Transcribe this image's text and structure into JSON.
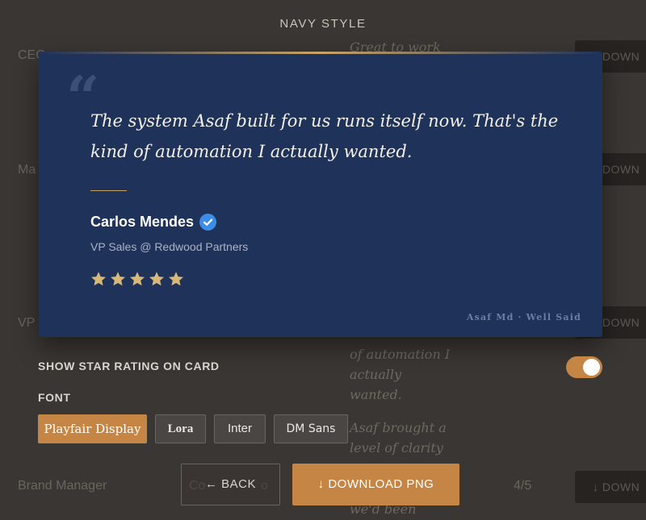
{
  "background": {
    "rows": [
      {
        "label": "CEO",
        "top": 0
      },
      {
        "label": "Ma",
        "top": 0
      },
      {
        "label": "VP",
        "top": 0
      },
      {
        "label": "Brand Manager",
        "top": 0
      }
    ],
    "company_partial": "Co",
    "company_partial_2": "o",
    "quotes": [
      "Great to work",
      "of automation I actually wanted.",
      "Asaf brought a level of clarity",
      "we'd been"
    ],
    "download_label": "↓ DOWN",
    "page_count": "4/5"
  },
  "modal": {
    "title": "NAVY STYLE"
  },
  "card": {
    "quote": "The system Asaf built for us runs itself now. That's the kind of automation I actually wanted.",
    "author_name": "Carlos Mendes",
    "author_role": "VP Sales @ Redwood Partners",
    "rating": 5,
    "watermark": "Asaf Md · Well Said",
    "colors": {
      "background": "#1f3259",
      "accent": "#c9a468",
      "verified": "#3d8de6"
    }
  },
  "settings": {
    "show_star_label": "SHOW STAR RATING ON CARD",
    "show_star_enabled": true,
    "font_label": "FONT",
    "fonts": [
      "Playfair Display",
      "Lora",
      "Inter",
      "DM Sans"
    ],
    "selected_font": "Playfair Display"
  },
  "actions": {
    "back_label": "← BACK",
    "download_label": "↓ DOWNLOAD PNG"
  },
  "accent_color": "#c58545"
}
